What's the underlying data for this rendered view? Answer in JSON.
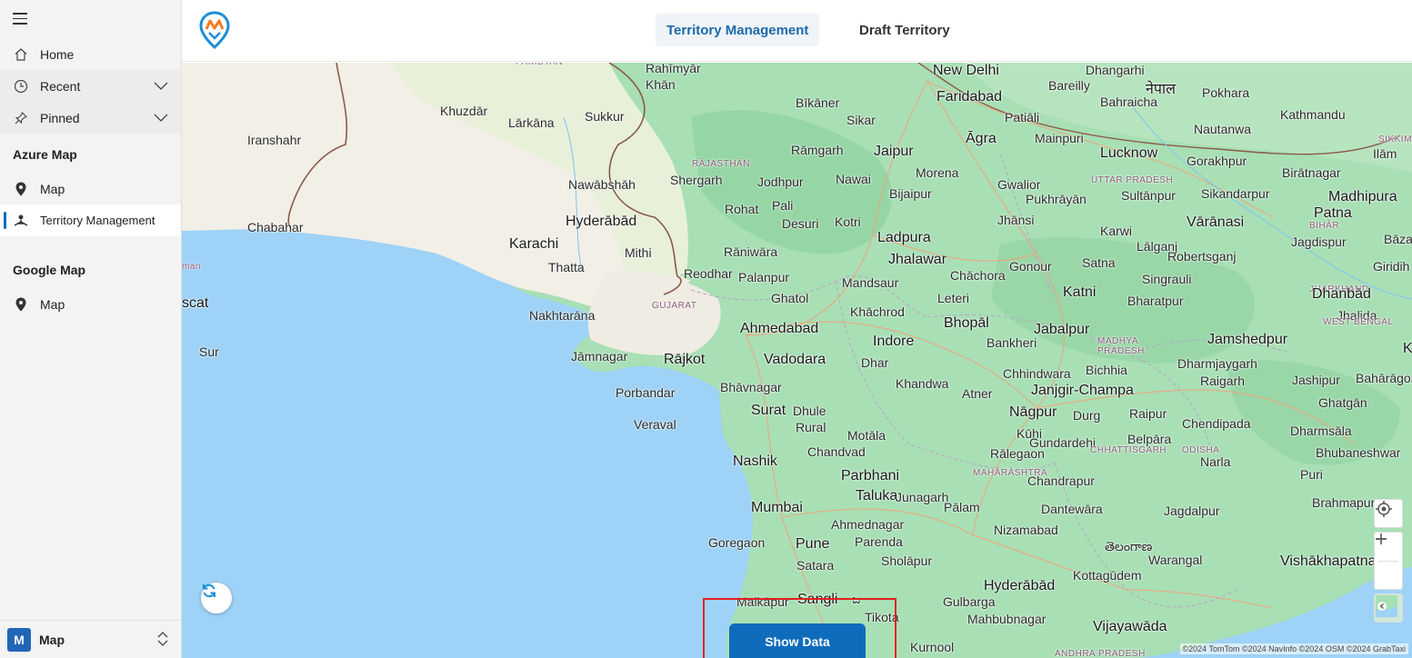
{
  "sidebar": {
    "items": [
      {
        "label": "Home"
      },
      {
        "label": "Recent"
      },
      {
        "label": "Pinned"
      }
    ],
    "groups": [
      {
        "title": "Azure Map",
        "items": [
          {
            "label": "Map"
          },
          {
            "label": "Territory Management"
          }
        ]
      },
      {
        "title": "Google Map",
        "items": [
          {
            "label": "Map"
          }
        ]
      }
    ],
    "footer": {
      "badge": "M",
      "label": "Map"
    }
  },
  "header": {
    "tabs": [
      {
        "label": "Territory Management",
        "active": true
      },
      {
        "label": "Draft Territory",
        "active": false
      }
    ]
  },
  "map": {
    "places": [
      {
        "text": "PAKISTAN"
      },
      {
        "text": "Rahīmyār"
      },
      {
        "text": "Khān"
      },
      {
        "text": "New Delhi"
      },
      {
        "text": "Dhangarhi"
      },
      {
        "text": "Faridabad"
      },
      {
        "text": "Bareilly"
      },
      {
        "text": "नेपाल"
      },
      {
        "text": "Pokhara"
      },
      {
        "text": "Khuzdār"
      },
      {
        "text": "Lārkāna"
      },
      {
        "text": "Sukkur"
      },
      {
        "text": "Bīkāner"
      },
      {
        "text": "Patiāli"
      },
      {
        "text": "Bahraicha"
      },
      {
        "text": "Kathmandu"
      },
      {
        "text": "Iranshahr"
      },
      {
        "text": "Sikar"
      },
      {
        "text": "Āgra"
      },
      {
        "text": "Mainpuri"
      },
      {
        "text": "Nautanwa"
      },
      {
        "text": "SIKKIM"
      },
      {
        "text": "Rāmgarh"
      },
      {
        "text": "Jaipur"
      },
      {
        "text": "Lucknow"
      },
      {
        "text": "Ilām"
      },
      {
        "text": "RĀJASTHĀN"
      },
      {
        "text": "Gorakhpur"
      },
      {
        "text": "Birātnagar"
      },
      {
        "text": "Nawābshāh"
      },
      {
        "text": "Shergarh"
      },
      {
        "text": "Morena"
      },
      {
        "text": "Nawai"
      },
      {
        "text": "UTTAR PRADESH"
      },
      {
        "text": "Jodhpur"
      },
      {
        "text": "Gwalior"
      },
      {
        "text": "Bijaipur"
      },
      {
        "text": "Pukhrāyān"
      },
      {
        "text": "Sultānpur"
      },
      {
        "text": "Sikandarpur"
      },
      {
        "text": "Madhipura"
      },
      {
        "text": "Chabahar"
      },
      {
        "text": "Hyderābād"
      },
      {
        "text": "Rohat"
      },
      {
        "text": "Pali"
      },
      {
        "text": "Jhānsi"
      },
      {
        "text": "Vārānasi"
      },
      {
        "text": "Patna"
      },
      {
        "text": "Desuri"
      },
      {
        "text": "Kotri"
      },
      {
        "text": "Karwi"
      },
      {
        "text": "BIHĀR"
      },
      {
        "text": "Bāza"
      },
      {
        "text": "Karachi"
      },
      {
        "text": "Mithi"
      },
      {
        "text": "Ladpura"
      },
      {
        "text": "Lālganj"
      },
      {
        "text": "Jagdispur"
      },
      {
        "text": "Rāniwāra"
      },
      {
        "text": "Jhalawar"
      },
      {
        "text": "Robertsganj"
      },
      {
        "text": "man"
      },
      {
        "text": "Thatta"
      },
      {
        "text": "Gonour"
      },
      {
        "text": "Satna"
      },
      {
        "text": "Giridih"
      },
      {
        "text": "Reodhar"
      },
      {
        "text": "Palanpur"
      },
      {
        "text": "Chāchora"
      },
      {
        "text": "Singrauli"
      },
      {
        "text": "scat"
      },
      {
        "text": "Mandsaur"
      },
      {
        "text": "JHARKHAND"
      },
      {
        "text": "Ghatol"
      },
      {
        "text": "Leteri"
      },
      {
        "text": "Katni"
      },
      {
        "text": "Bharatpur"
      },
      {
        "text": "Dhanbād"
      },
      {
        "text": "Nakhtarāna"
      },
      {
        "text": "GUJARAT"
      },
      {
        "text": "Khāchrod"
      },
      {
        "text": "Jhalida"
      },
      {
        "text": "Ahmedabad"
      },
      {
        "text": "Bhopāl"
      },
      {
        "text": "Jabalpur"
      },
      {
        "text": "WEST BENGAL"
      },
      {
        "text": "Sur"
      },
      {
        "text": "Indore"
      },
      {
        "text": "Bankheri"
      },
      {
        "text": "MADHYA"
      },
      {
        "text": "PRADESH"
      },
      {
        "text": "Jamshedpur"
      },
      {
        "text": "Jāmnagar"
      },
      {
        "text": "Rājkot"
      },
      {
        "text": "Vadodara"
      },
      {
        "text": "Dhar"
      },
      {
        "text": "Bichhia"
      },
      {
        "text": "Dharmjaygarh"
      },
      {
        "text": "Ko"
      },
      {
        "text": "Chhindwara"
      },
      {
        "text": "Raigarh"
      },
      {
        "text": "Jashipur"
      },
      {
        "text": "Bahārāgora"
      },
      {
        "text": "Porbandar"
      },
      {
        "text": "Bhāvnagar"
      },
      {
        "text": "Khandwa"
      },
      {
        "text": "Atner"
      },
      {
        "text": "Janjgir-Champa"
      },
      {
        "text": "Ghatgān"
      },
      {
        "text": "Surat"
      },
      {
        "text": "Dhule"
      },
      {
        "text": "Nāgpur"
      },
      {
        "text": "Durg"
      },
      {
        "text": "Raipur"
      },
      {
        "text": "Chendipada"
      },
      {
        "text": "Veraval"
      },
      {
        "text": "Rural"
      },
      {
        "text": "Dharmsāla"
      },
      {
        "text": "Motāla"
      },
      {
        "text": "Kūhi"
      },
      {
        "text": "Gundardehi"
      },
      {
        "text": "Bhubaneshwar"
      },
      {
        "text": "Chandvad"
      },
      {
        "text": "Rālegaon"
      },
      {
        "text": "CHHATTISGARH"
      },
      {
        "text": "Belpāra"
      },
      {
        "text": "ODISHA"
      },
      {
        "text": "Nashik"
      },
      {
        "text": "MAHĀRĀSHTRA"
      },
      {
        "text": "Narla"
      },
      {
        "text": "Parbhani"
      },
      {
        "text": "Chandrapur"
      },
      {
        "text": "Puri"
      },
      {
        "text": "Taluka"
      },
      {
        "text": "Junagarh"
      },
      {
        "text": "Brahmapur"
      },
      {
        "text": "Mumbai"
      },
      {
        "text": "Pālam"
      },
      {
        "text": "Dantewāra"
      },
      {
        "text": "Ahmednagar"
      },
      {
        "text": "Jagdalpur"
      },
      {
        "text": "Nizamabad"
      },
      {
        "text": "తెలంగాణ"
      },
      {
        "text": "Goregaon"
      },
      {
        "text": "Pune"
      },
      {
        "text": "Parenda"
      },
      {
        "text": "Warangal"
      },
      {
        "text": "Vishākhapatnam"
      },
      {
        "text": "Sholāpur"
      },
      {
        "text": "Satara"
      },
      {
        "text": "Hyderābād"
      },
      {
        "text": "Kottagūdem"
      },
      {
        "text": "Malkāpur"
      },
      {
        "text": "Sangli"
      },
      {
        "text": "ಜ"
      },
      {
        "text": "Gulbarga"
      },
      {
        "text": "Tikota"
      },
      {
        "text": "Mahbubnagar"
      },
      {
        "text": "Vijayawāda"
      },
      {
        "text": "Kurnool"
      },
      {
        "text": "ANDHRA PRADESH"
      }
    ],
    "attribution": "©2024 TomTom  ©2024 NavInfo  ©2024 OSM  ©2024 GrabTaxi",
    "show_data_label": "Show Data",
    "colors": {
      "sea": "#9ed2f6",
      "land": "#a8dfb5",
      "desert": "#f2efe6",
      "accent": "#0f6cbd",
      "highlight_box": "#e02020"
    }
  }
}
